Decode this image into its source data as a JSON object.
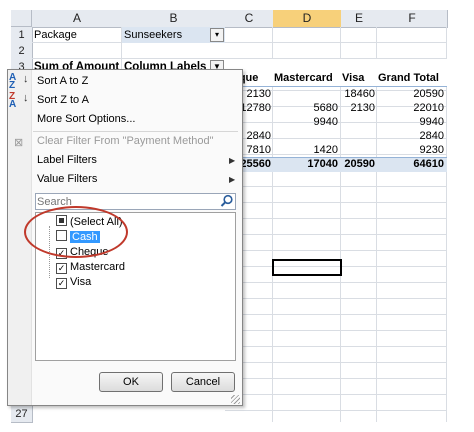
{
  "sheet": {
    "corner": "",
    "columns": [
      "A",
      "B",
      "C",
      "D",
      "E",
      "F"
    ],
    "rows": [
      "1",
      "2",
      "3"
    ],
    "bottom_row": "27",
    "cells": {
      "a1": "Package",
      "b1": "Sunseekers",
      "a3": "Sum of Amount",
      "b3": "Column Labels",
      "c3": "heque",
      "d3": "Mastercard",
      "e3": "Visa",
      "f3": "Grand Total"
    },
    "data_rows": [
      {
        "c": "2130",
        "d": "",
        "e": "18460",
        "f": "20590"
      },
      {
        "c": "12780",
        "d": "5680",
        "e": "2130",
        "f": "22010"
      },
      {
        "c": "",
        "d": "9940",
        "e": "",
        "f": "9940"
      },
      {
        "c": "2840",
        "d": "",
        "e": "",
        "f": "2840"
      },
      {
        "c": "7810",
        "d": "1420",
        "e": "",
        "f": "9230"
      }
    ],
    "total_row": {
      "c": "25560",
      "d": "17040",
      "e": "20590",
      "f": "64610"
    }
  },
  "menu": {
    "sort_az": "Sort A to Z",
    "sort_za": "Sort Z to A",
    "more_sort": "More Sort Options...",
    "clear_filter": "Clear Filter From \"Payment Method\"",
    "label_filters": "Label Filters",
    "value_filters": "Value Filters",
    "search_placeholder": "Search",
    "items": [
      {
        "label": "(Select All)",
        "state": "partial"
      },
      {
        "label": "Cash",
        "state": "unchecked"
      },
      {
        "label": "Cheque",
        "state": "checked"
      },
      {
        "label": "Mastercard",
        "state": "checked"
      },
      {
        "label": "Visa",
        "state": "checked"
      }
    ],
    "ok": "OK",
    "cancel": "Cancel"
  },
  "colors": {
    "header_bg": "#e6eaf0",
    "selected_header": "#f7d07a",
    "total_row_bg": "#dbe5f1",
    "highlight": "#3399ff",
    "annotation": "#c0392b"
  },
  "icons": {
    "filter_button": "filter-funnel-icon",
    "dropdown": "dropdown-arrow-icon",
    "search": "magnifier-icon"
  }
}
